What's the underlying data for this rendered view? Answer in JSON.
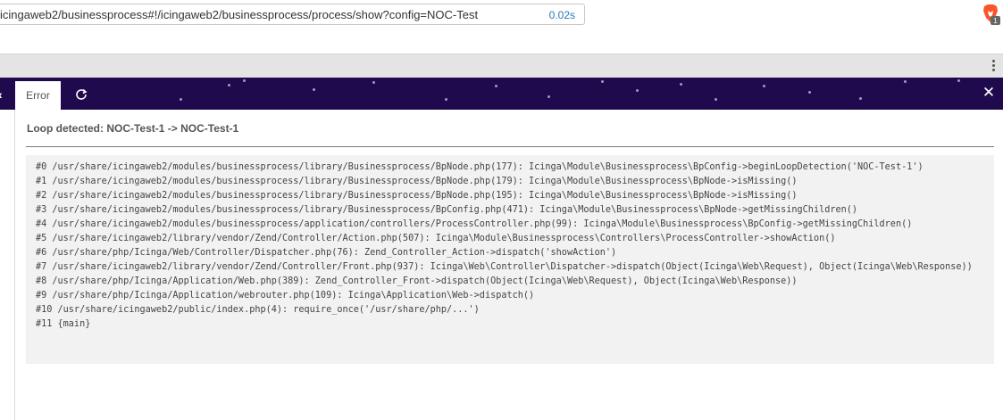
{
  "browser": {
    "url": "icingaweb2/businessprocess#!/icingaweb2/businessprocess/process/show?config=NOC-Test",
    "load_time": "0.02s",
    "extension_badge": "1"
  },
  "tabs": {
    "error_label": "Error"
  },
  "error": {
    "title": "Loop detected: NOC-Test-1 -> NOC-Test-1",
    "trace": [
      "#0 /usr/share/icingaweb2/modules/businessprocess/library/Businessprocess/BpNode.php(177): Icinga\\Module\\Businessprocess\\BpConfig->beginLoopDetection('NOC-Test-1')",
      "#1 /usr/share/icingaweb2/modules/businessprocess/library/Businessprocess/BpNode.php(179): Icinga\\Module\\Businessprocess\\BpNode->isMissing()",
      "#2 /usr/share/icingaweb2/modules/businessprocess/library/Businessprocess/BpNode.php(195): Icinga\\Module\\Businessprocess\\BpNode->isMissing()",
      "#3 /usr/share/icingaweb2/modules/businessprocess/library/Businessprocess/BpConfig.php(471): Icinga\\Module\\Businessprocess\\BpNode->getMissingChildren()",
      "#4 /usr/share/icingaweb2/modules/businessprocess/application/controllers/ProcessController.php(99): Icinga\\Module\\Businessprocess\\BpConfig->getMissingChildren()",
      "#5 /usr/share/icingaweb2/library/vendor/Zend/Controller/Action.php(507): Icinga\\Module\\Businessprocess\\Controllers\\ProcessController->showAction()",
      "#6 /usr/share/php/Icinga/Web/Controller/Dispatcher.php(76): Zend_Controller_Action->dispatch('showAction')",
      "#7 /usr/share/icingaweb2/library/vendor/Zend/Controller/Front.php(937): Icinga\\Web\\Controller\\Dispatcher->dispatch(Object(Icinga\\Web\\Request), Object(Icinga\\Web\\Response))",
      "#8 /usr/share/php/Icinga/Application/Web.php(389): Zend_Controller_Front->dispatch(Object(Icinga\\Web\\Request), Object(Icinga\\Web\\Response))",
      "#9 /usr/share/php/Icinga/Application/webrouter.php(109): Icinga\\Application\\Web->dispatch()",
      "#10 /usr/share/icingaweb2/public/index.php(4): require_once('/usr/share/php/...')",
      "#11 {main}"
    ]
  },
  "colors": {
    "header_bg": "#1e0a4d",
    "trace_bg": "#f2f2f2",
    "url_time": "#2a7ab8"
  },
  "icons": [
    "brave-icon",
    "kebab-menu-icon",
    "chevron-left-icon",
    "refresh-icon",
    "close-icon"
  ]
}
